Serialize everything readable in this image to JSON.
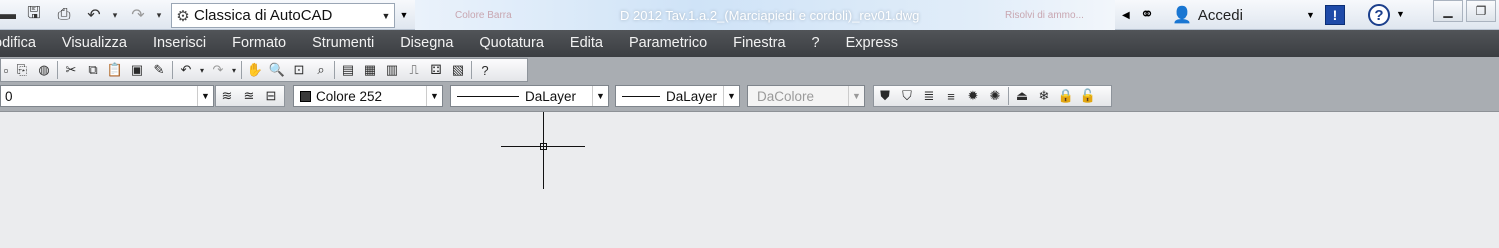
{
  "quick_access": {
    "workspace": "Classica di AutoCAD"
  },
  "title": {
    "text": "D 2012    Tav.1.a.2_(Marciapiedi e cordoli)_rev01.dwg",
    "ghost_left": "Colore Barra",
    "ghost_right": "Risolvi di ammo..."
  },
  "signin": {
    "label": "Accedi"
  },
  "help": {
    "glyph": "?"
  },
  "menubar": {
    "items": [
      "odifica",
      "Visualizza",
      "Inserisci",
      "Formato",
      "Strumenti",
      "Disegna",
      "Quotatura",
      "Edita",
      "Parametrico",
      "Finestra",
      "?",
      "Express"
    ]
  },
  "properties": {
    "layer": "0",
    "color": "Colore 252",
    "linetype": "DaLayer",
    "lineweight": "DaLayer",
    "plotstyle": "DaColore"
  },
  "icons": {
    "help_badge": "!"
  }
}
